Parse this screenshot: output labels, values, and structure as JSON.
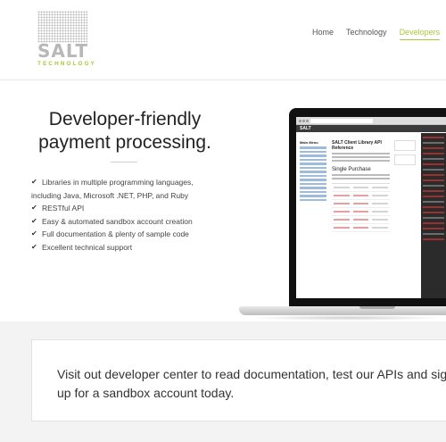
{
  "brand": {
    "logo_text": "SALT",
    "logo_subtext": "TECHNOLOGY",
    "accent_color": "#a8c93b"
  },
  "nav": {
    "items": [
      {
        "label": "Home",
        "active": false
      },
      {
        "label": "Technology",
        "active": false
      },
      {
        "label": "Developers",
        "active": true
      }
    ]
  },
  "hero": {
    "title_line1": "Developer-friendly",
    "title_line2": "payment processing.",
    "features": [
      "Libraries in multiple programming languages,",
      "including Java, Microsoft .NET, PHP, and Ruby",
      "RESTful API",
      "Easy & automated sandbox account creation",
      "Full documentation & plenty of sample code",
      "Excellent technical support"
    ],
    "feature_icon": "check-icon"
  },
  "screen_preview": {
    "site_name": "SALT",
    "sidebar_heading": "Main Menu",
    "page_heading": "SALT Client Library API Reference",
    "section_heading": "Single Purchase"
  },
  "callout": {
    "text": "Visit out developer center to read documentation, test our APIs and sign up for a sandbox account today."
  }
}
